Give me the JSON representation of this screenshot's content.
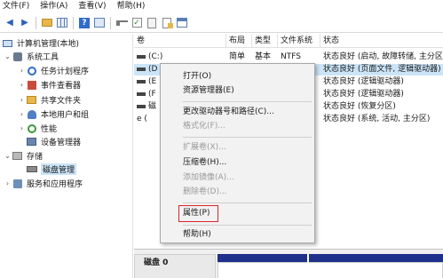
{
  "menubar": [
    "文件(F)",
    "操作(A)",
    "查看(V)",
    "帮助(H)"
  ],
  "toolbar": [
    "back-arrow-icon",
    "forward-arrow-icon",
    "folder-icon",
    "grid-icon",
    "help-icon",
    "panel-icon",
    "key-icon",
    "check-icon",
    "page-icon",
    "doc-icon",
    "properties-icon"
  ],
  "tree": {
    "root": "计算机管理(本地)",
    "system_tools": "系统工具",
    "task_scheduler": "任务计划程序",
    "event_viewer": "事件查看器",
    "shared_folders": "共享文件夹",
    "local_users": "本地用户和组",
    "performance": "性能",
    "device_manager": "设备管理器",
    "storage": "存储",
    "disk_management": "磁盘管理",
    "services_apps": "服务和应用程序"
  },
  "columns": [
    "卷",
    "布局",
    "类型",
    "文件系统",
    "状态"
  ],
  "rows": [
    {
      "vol": "(C:)",
      "layout": "简单",
      "type": "基本",
      "fs": "NTFS",
      "status": "状态良好 (启动, 故障转储, 主分区)"
    },
    {
      "vol": "(D",
      "layout": "",
      "type": "",
      "fs": "",
      "status": "状态良好 (页面文件, 逻辑驱动器)"
    },
    {
      "vol": "(E",
      "layout": "",
      "type": "",
      "fs": "",
      "status": "状态良好 (逻辑驱动器)"
    },
    {
      "vol": "(F",
      "layout": "",
      "type": "",
      "fs": "",
      "status": "状态良好 (逻辑驱动器)"
    },
    {
      "vol": "磁",
      "layout": "",
      "type": "",
      "fs": "",
      "status": "状态良好 (恢复分区)"
    },
    {
      "vol": "e (",
      "layout": "",
      "type": "",
      "fs": "",
      "status": "状态良好 (系统, 活动, 主分区)"
    }
  ],
  "disk": {
    "label": "磁盘 0"
  },
  "context_menu": {
    "open": "打开(O)",
    "explorer": "资源管理器(E)",
    "change_letter": "更改驱动器号和路径(C)...",
    "format": "格式化(F)...",
    "extend": "扩展卷(X)...",
    "shrink": "压缩卷(H)...",
    "add_mirror": "添加镜像(A)...",
    "delete": "删除卷(D)...",
    "properties": "属性(P)",
    "help": "帮助(H)"
  }
}
